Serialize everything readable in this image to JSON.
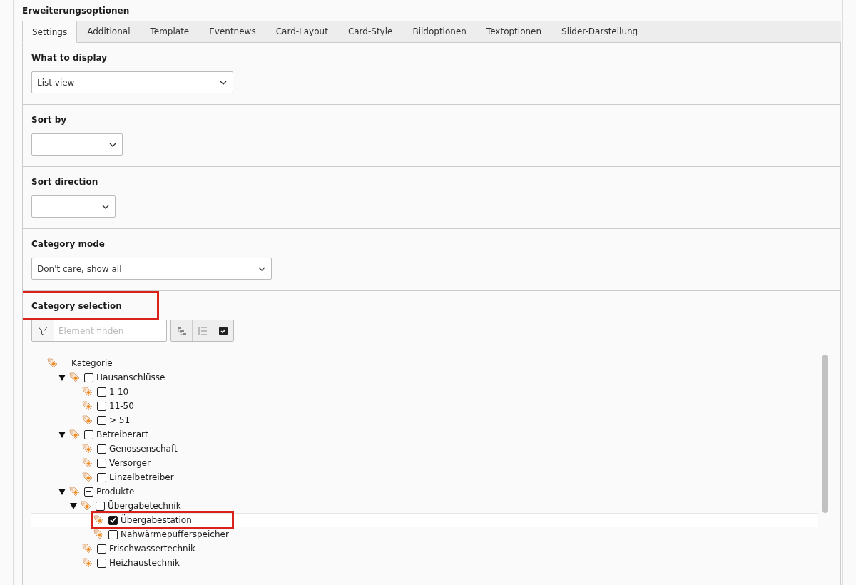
{
  "panel": {
    "title": "Erweiterungsoptionen"
  },
  "tabs": [
    {
      "label": "Settings",
      "selected": true
    },
    {
      "label": "Additional",
      "selected": false
    },
    {
      "label": "Template",
      "selected": false
    },
    {
      "label": "Eventnews",
      "selected": false
    },
    {
      "label": "Card-Layout",
      "selected": false
    },
    {
      "label": "Card-Style",
      "selected": false
    },
    {
      "label": "Bildoptionen",
      "selected": false
    },
    {
      "label": "Textoptionen",
      "selected": false
    },
    {
      "label": "Slider-Darstellung",
      "selected": false
    }
  ],
  "fields": [
    {
      "label": "What to display",
      "value": "List view"
    },
    {
      "label": "Sort by"
    },
    {
      "label": "Sort direction"
    },
    {
      "label": "Category mode",
      "value": "Don't care, show all"
    }
  ],
  "category_selection": {
    "label": "Category selection",
    "highlighted": true,
    "search": {
      "placeholder": "Element finden"
    },
    "tree": [
      {
        "label": "Kategorie",
        "selected": false,
        "children": [
          {
            "label": "Hausanschlüsse",
            "checked": false,
            "selected": false,
            "expanded": true,
            "children": [
              {
                "label": "1-10",
                "checked": false,
                "selected": false
              },
              {
                "label": "11-50",
                "checked": false,
                "selected": false
              },
              {
                "label": "> 51",
                "checked": false,
                "selected": false
              }
            ]
          },
          {
            "label": "Betreiberart",
            "checked": false,
            "selected": false,
            "expanded": true,
            "children": [
              {
                "label": "Genossenschaft",
                "checked": false,
                "selected": false
              },
              {
                "label": "Versorger",
                "checked": false,
                "selected": false
              },
              {
                "label": "Einzelbetreiber",
                "checked": false,
                "selected": false
              }
            ]
          },
          {
            "label": "Produkte",
            "indeterminate": true,
            "selected": false,
            "expanded": true,
            "children": [
              {
                "label": "Übergabetechnik",
                "checked": false,
                "selected": false,
                "expanded": true,
                "children": [
                  {
                    "label": "Übergabestation",
                    "checked": true,
                    "selected": true,
                    "highlighted": true
                  },
                  {
                    "label": "Nahwärmepufferspeicher",
                    "checked": false,
                    "selected": false
                  }
                ]
              },
              {
                "label": "Frischwassertechnik",
                "checked": false,
                "selected": false
              },
              {
                "label": "Heizhaustechnik",
                "checked": false,
                "selected": false
              }
            ]
          }
        ]
      }
    ]
  }
}
